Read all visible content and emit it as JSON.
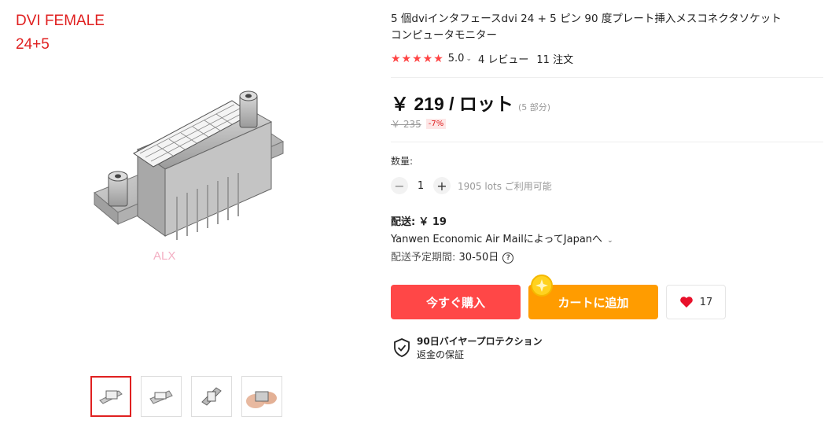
{
  "overlay": {
    "line1": "DVI FEMALE",
    "line2": "24+5"
  },
  "watermark": "ALX",
  "product": {
    "title": "5 個dviインタフェースdvi 24 + 5 ピン 90 度プレート挿入メスコネクタソケットコンピュータモニター",
    "stars": "★★★★★",
    "rating": "5.0",
    "reviews": "4 レビュー",
    "orders": "11 注文"
  },
  "price": {
    "current": "￥ 219 / ロット",
    "pieces": "(5 部分)",
    "old": "￥ 235",
    "discount": "-7%"
  },
  "quantity": {
    "label": "数量:",
    "value": "1",
    "available": "1905 lots ご利用可能"
  },
  "shipping": {
    "fee_label": "配送:",
    "fee_value": "￥ 19",
    "method": "Yanwen Economic Air MailによってJapanへ",
    "delivery_label": "配送予定期間:",
    "delivery_value": "30-50日"
  },
  "buttons": {
    "buy": "今すぐ購入",
    "cart": "カートに追加",
    "wishlist_count": "17"
  },
  "protection": {
    "title": "90日バイヤープロテクション",
    "subtitle": "返金の保証"
  },
  "colors": {
    "accent_red": "#ff4747",
    "cart_orange": "#ff9c00",
    "star": "#ff4747"
  },
  "icons": [
    "chevron-down-icon",
    "minus-icon",
    "plus-icon",
    "question-icon",
    "heart-icon",
    "shield-check-icon",
    "coin-icon"
  ]
}
